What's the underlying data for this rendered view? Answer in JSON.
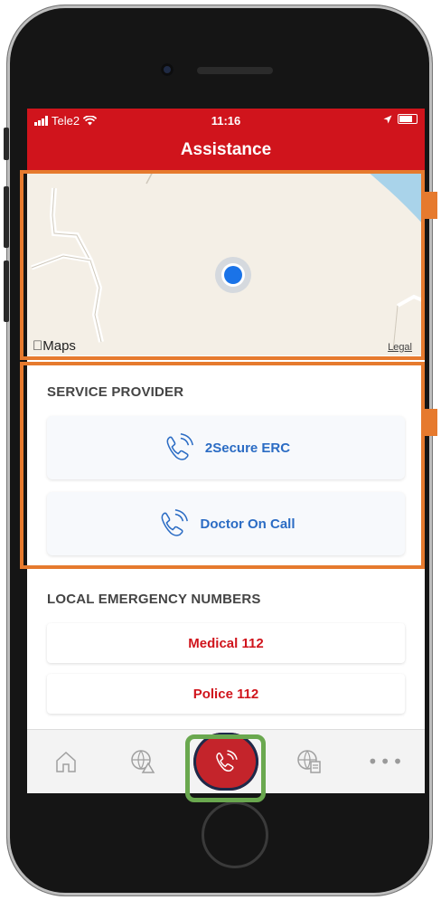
{
  "status_bar": {
    "carrier": "Tele2",
    "time": "11:16"
  },
  "header": {
    "title": "Assistance"
  },
  "map": {
    "maps_label": "Maps",
    "legal_label": "Legal"
  },
  "service_provider": {
    "title": "SERVICE PROVIDER",
    "items": [
      {
        "label": "2Secure ERC"
      },
      {
        "label": "Doctor On Call"
      }
    ]
  },
  "local_emergency": {
    "title": "LOCAL EMERGENCY NUMBERS",
    "items": [
      {
        "label": "Medical 112"
      },
      {
        "label": "Police 112"
      }
    ]
  },
  "tab_bar": {
    "items": [
      {
        "icon": "home-icon"
      },
      {
        "icon": "globe-alert-icon"
      },
      {
        "icon": "phone-call-icon",
        "active": true
      },
      {
        "icon": "globe-document-icon"
      },
      {
        "icon": "more-icon"
      }
    ]
  },
  "colors": {
    "brand_red": "#d0141c",
    "link_blue": "#2b6cc4",
    "annotation_orange": "#e67a2e",
    "annotation_green": "#6aa84f"
  }
}
